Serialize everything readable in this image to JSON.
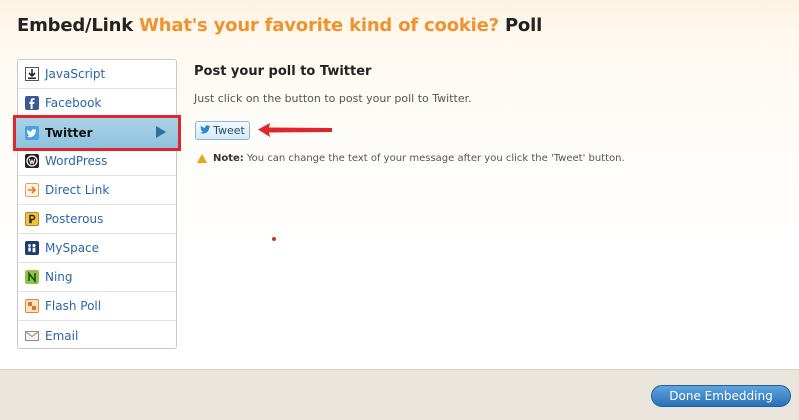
{
  "header": {
    "prefix": "Embed/Link",
    "question": "What's your favorite kind of cookie?",
    "suffix": "Poll"
  },
  "sidebar": {
    "items": [
      {
        "label": "JavaScript",
        "icon": "download-icon"
      },
      {
        "label": "Facebook",
        "icon": "facebook-icon"
      },
      {
        "label": "Twitter",
        "icon": "twitter-icon",
        "active": true
      },
      {
        "label": "WordPress",
        "icon": "wordpress-icon"
      },
      {
        "label": "Direct Link",
        "icon": "link-arrow-icon"
      },
      {
        "label": "Posterous",
        "icon": "posterous-icon"
      },
      {
        "label": "MySpace",
        "icon": "myspace-icon"
      },
      {
        "label": "Ning",
        "icon": "ning-icon"
      },
      {
        "label": "Flash Poll",
        "icon": "flash-icon"
      },
      {
        "label": "Email",
        "icon": "envelope-icon"
      }
    ]
  },
  "main": {
    "heading": "Post your poll to Twitter",
    "description": "Just click on the button to post your poll to Twitter.",
    "tweet_button": "Tweet",
    "note_label": "Note:",
    "note_text": "You can change the text of your message after you click the 'Tweet' button."
  },
  "footer": {
    "done_button": "Done Embedding"
  },
  "colors": {
    "accent": "#f0922e",
    "highlight_border": "#e0262a",
    "active_bg": "#9ccbe2",
    "link": "#2a66a6",
    "button_blue": "#2a70b8"
  }
}
